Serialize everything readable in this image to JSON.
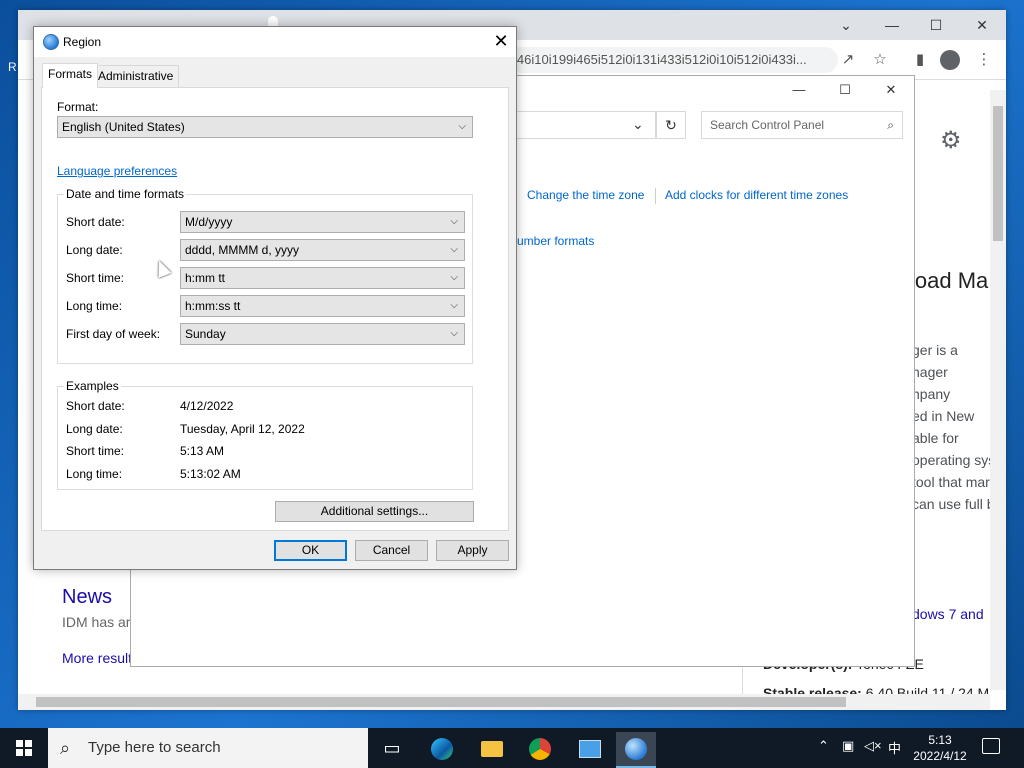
{
  "desktop": {
    "label": "R"
  },
  "browser": {
    "url": "i46i10i199i465i512i0i131i433i512i0i10i512i0i433i...",
    "news_heading": "News",
    "news_snippet": "IDM has ar",
    "more_results": "More result",
    "wiki": {
      "title_fragment": "load Ma",
      "lines": [
        "ger is a",
        "nager",
        "npany",
        "ed in New",
        "able for",
        "operating sys",
        "tool that mar",
        "can use full b"
      ],
      "link_fragment": "dows 7 and",
      "developer_label": "Developer(s):",
      "developer_value": "Tonec FZE",
      "stable_label": "Stable release:",
      "stable_value": "6.40 Build 11 / 24 M"
    }
  },
  "control_panel": {
    "search_placeholder": "Search Control Panel",
    "link_change_timezone": "Change the time zone",
    "link_add_clocks": "Add clocks for different time zones",
    "link_number_formats": "umber formats"
  },
  "region_dialog": {
    "title": "Region",
    "tabs": [
      "Formats",
      "Administrative"
    ],
    "format_label": "Format:",
    "format_value": "English (United States)",
    "language_prefs": "Language preferences",
    "dt_group_title": "Date and time formats",
    "dt_rows": [
      {
        "label": "Short date:",
        "value": "M/d/yyyy"
      },
      {
        "label": "Long date:",
        "value": "dddd, MMMM d, yyyy"
      },
      {
        "label": "Short time:",
        "value": "h:mm tt"
      },
      {
        "label": "Long time:",
        "value": "h:mm:ss tt"
      },
      {
        "label": "First day of week:",
        "value": "Sunday"
      }
    ],
    "examples_title": "Examples",
    "examples": [
      {
        "label": "Short date:",
        "value": "4/12/2022"
      },
      {
        "label": "Long date:",
        "value": "Tuesday, April 12, 2022"
      },
      {
        "label": "Short time:",
        "value": "5:13 AM"
      },
      {
        "label": "Long time:",
        "value": "5:13:02 AM"
      }
    ],
    "additional_settings": "Additional settings...",
    "ok": "OK",
    "cancel": "Cancel",
    "apply": "Apply"
  },
  "taskbar": {
    "search_placeholder": "Type here to search",
    "ime": "中",
    "time": "5:13",
    "date": "2022/4/12"
  }
}
